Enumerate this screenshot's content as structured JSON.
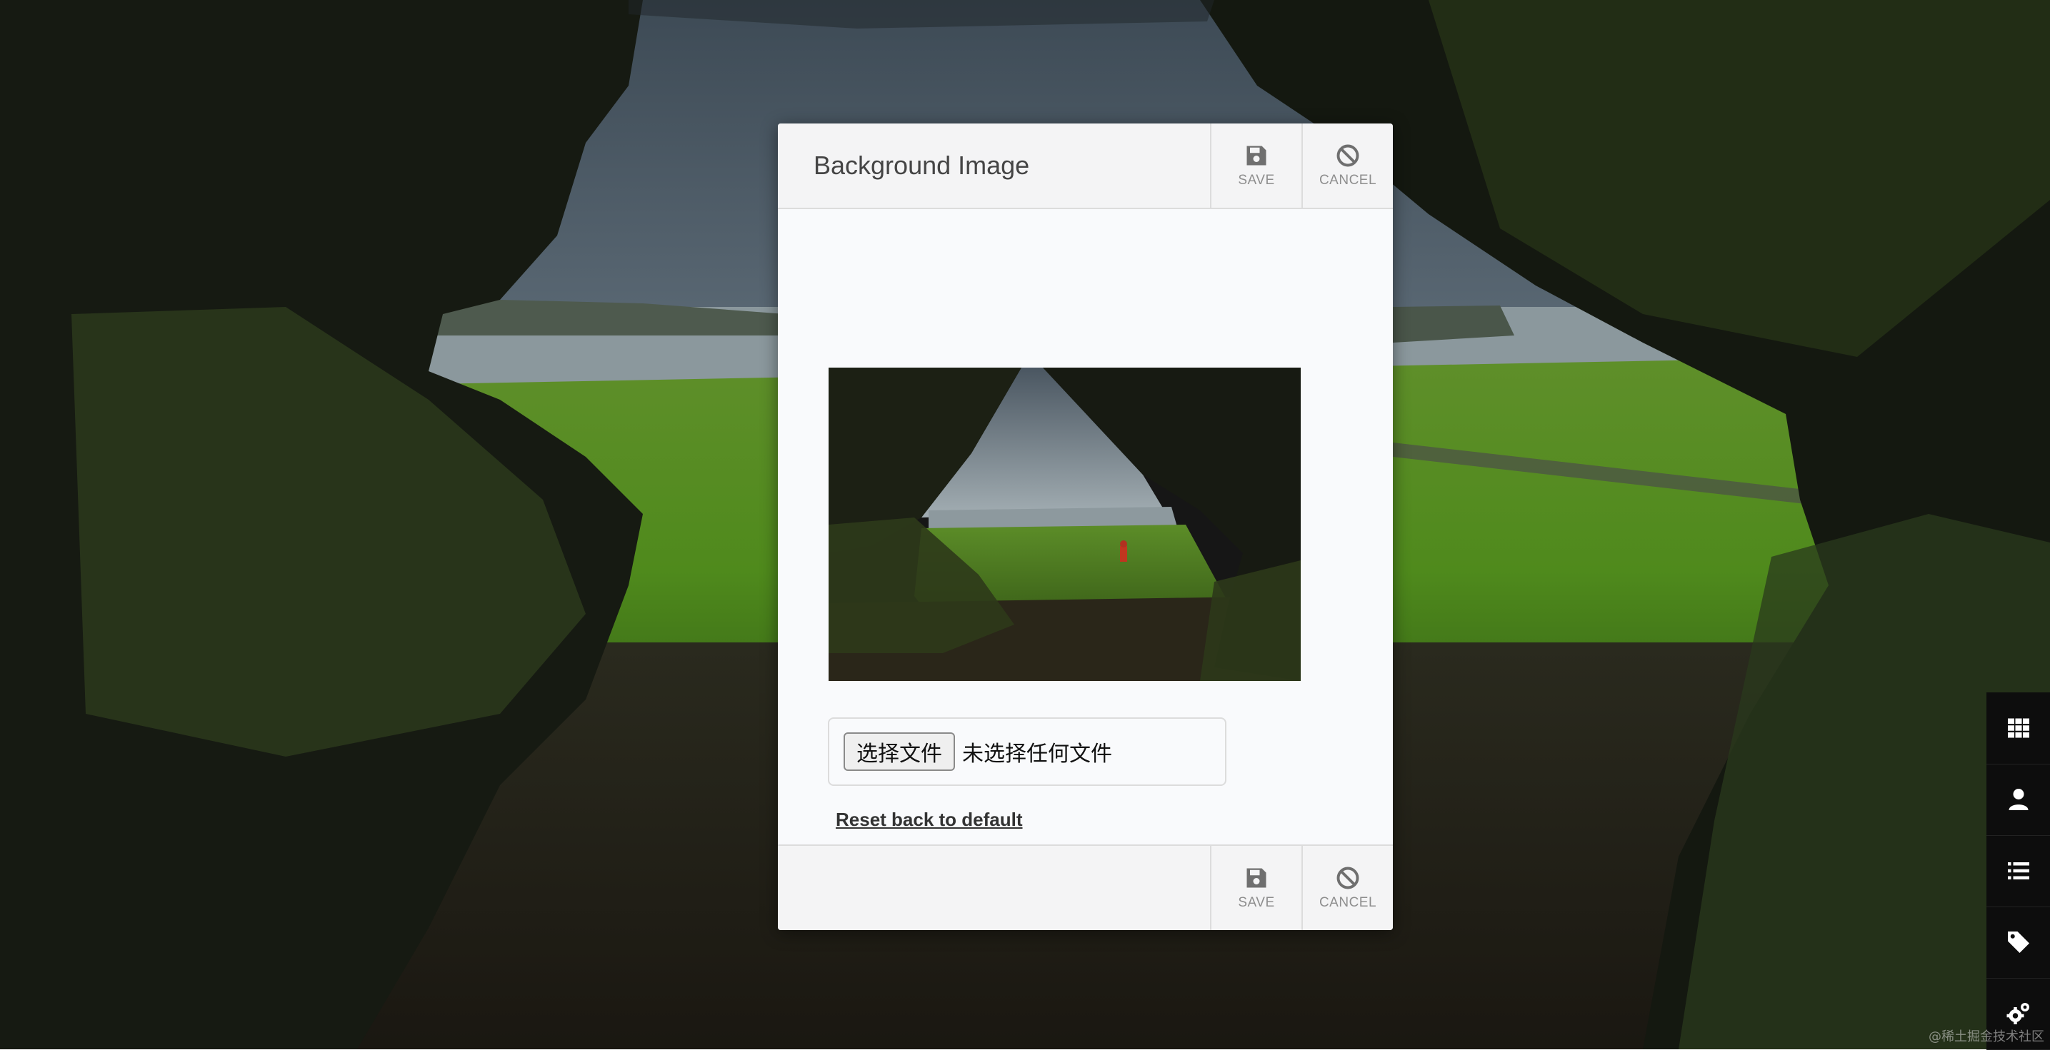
{
  "modal": {
    "title": "Background Image",
    "header_actions": [
      {
        "label": "SAVE",
        "icon": "floppy-disk-icon"
      },
      {
        "label": "CANCEL",
        "icon": "ban-icon"
      }
    ],
    "footer_actions": [
      {
        "label": "SAVE",
        "icon": "floppy-disk-icon"
      },
      {
        "label": "CANCEL",
        "icon": "ban-icon"
      }
    ],
    "file_input": {
      "button_label": "选择文件",
      "status_text": "未选择任何文件"
    },
    "reset_link": "Reset back to default"
  },
  "dock": {
    "items": [
      {
        "icon": "grid-icon"
      },
      {
        "icon": "user-icon"
      },
      {
        "icon": "list-icon"
      },
      {
        "icon": "tag-icon"
      },
      {
        "icon": "gear-icon"
      }
    ]
  },
  "watermark": "@稀土掘金技术社区",
  "colors": {
    "modal_bg": "#f9fafc",
    "header_bg": "#f4f4f5",
    "dock_bg": "#0d0d0d",
    "icon_gray": "#6f6f6f"
  }
}
